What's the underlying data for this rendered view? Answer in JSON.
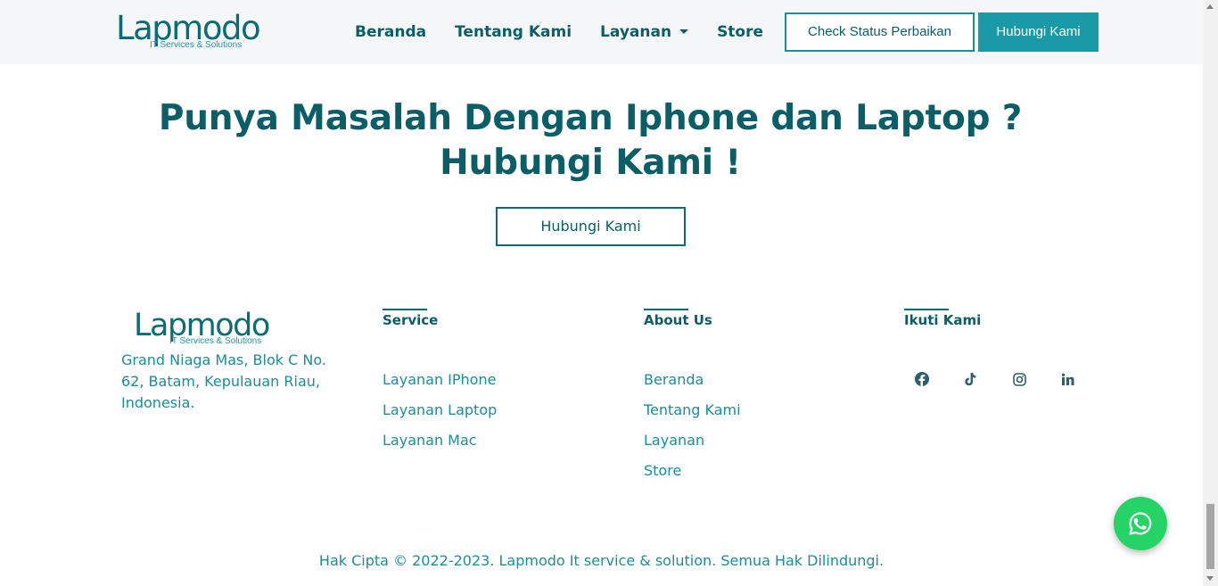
{
  "brand": {
    "name": "Lapmodo",
    "tagline": "IT Services & Solutions",
    "accent_color": "#1a9aa6",
    "text_color": "#0c5e66"
  },
  "nav": {
    "links": [
      "Beranda",
      "Tentang Kami",
      "Layanan",
      "Store"
    ],
    "check_status_label": "Check Status Perbaikan",
    "contact_label": "Hubungi Kami"
  },
  "hero": {
    "title_line1": "Punya Masalah Dengan Iphone dan Laptop ?",
    "title_line2": "Hubungi Kami !",
    "button_label": "Hubungi Kami"
  },
  "footer": {
    "address": "Grand Niaga Mas, Blok C No. 62, Batam, Kepulauan Riau, Indonesia.",
    "service": {
      "title": "Service",
      "links": [
        "Layanan IPhone",
        "Layanan Laptop",
        "Layanan Mac"
      ]
    },
    "about": {
      "title": "About Us",
      "links": [
        "Beranda",
        "Tentang Kami",
        "Layanan",
        "Store"
      ]
    },
    "follow": {
      "title": "Ikuti Kami",
      "icons": [
        "facebook-icon",
        "tiktok-icon",
        "instagram-icon",
        "linkedin-icon"
      ]
    },
    "copyright": "Hak Cipta © 2022-2023. Lapmodo It service & solution. Semua Hak Dilindungi."
  },
  "floating": {
    "icon": "whatsapp-icon",
    "color": "#25d366"
  }
}
